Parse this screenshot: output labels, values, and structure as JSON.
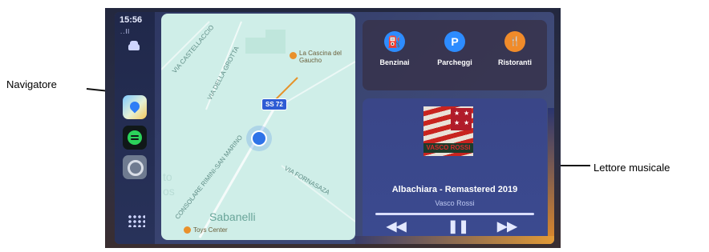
{
  "status": {
    "time": "15:56",
    "signal": "..ll"
  },
  "map": {
    "roads": [
      "VIA DELLA GROTTA",
      "VIA CASTELLACCIO",
      "CONSOLARE RIMINI-SAN MARINO",
      "VIA FORNASAZA"
    ],
    "route_badge": "SS 72",
    "poi_1": "La Cascina del Gaucho",
    "poi_2": "Toys Center",
    "town": "Sabanelli",
    "partial_1": "to",
    "partial_2": "os"
  },
  "quick_actions": [
    {
      "label": "Benzinai",
      "icon": "fuel-icon",
      "color": "#2d8cff",
      "glyph": "⛽"
    },
    {
      "label": "Parcheggi",
      "icon": "parking-icon",
      "color": "#2d8cff",
      "glyph": "P"
    },
    {
      "label": "Ristoranti",
      "icon": "fork-knife-icon",
      "color": "#f08b2a",
      "glyph": "🍴"
    }
  ],
  "music": {
    "title": "Albachiara - Remastered 2019",
    "artist": "Vasco Rossi",
    "cover_text": "VASCO ROSSI",
    "progress": 1.0,
    "controls": {
      "prev": "◀◀",
      "pause": "❚❚",
      "next": "▶▶"
    }
  },
  "callouts": {
    "left": "Navigatore",
    "right": "Lettore musicale"
  }
}
